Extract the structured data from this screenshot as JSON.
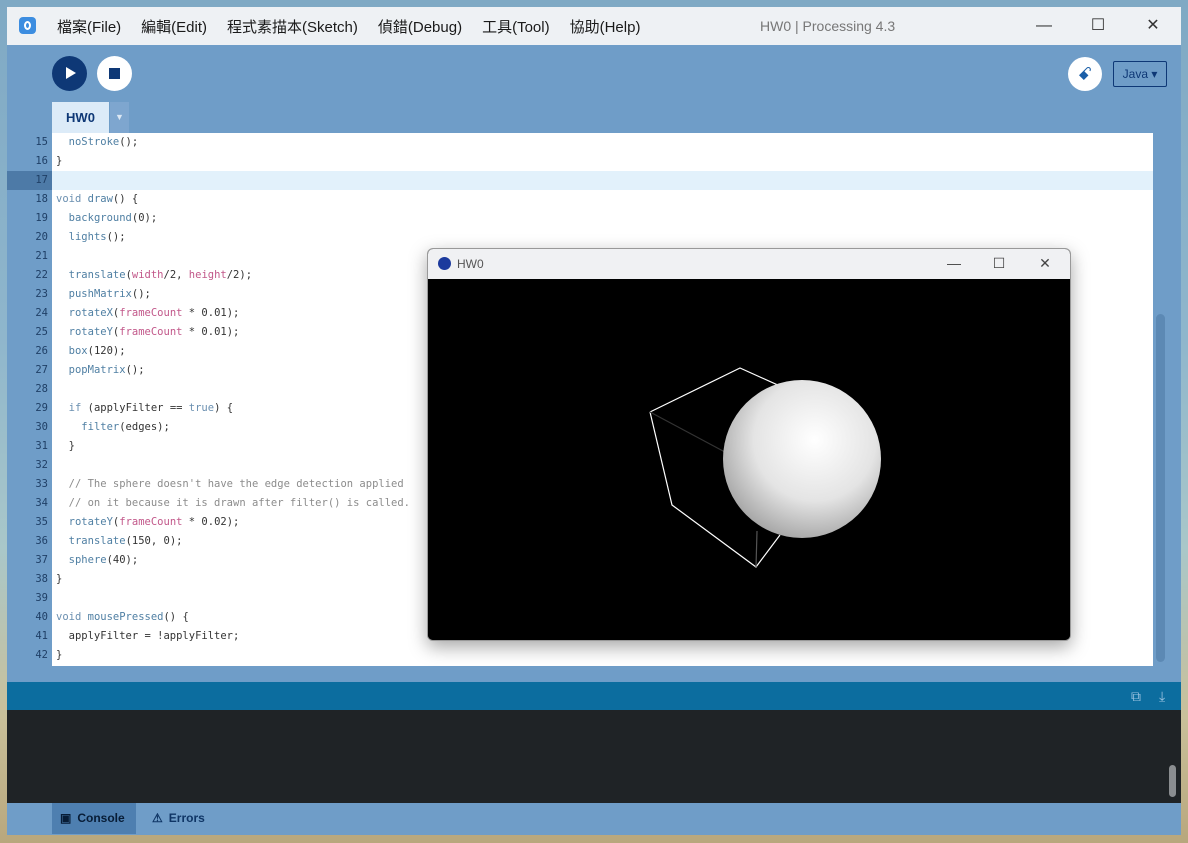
{
  "titlebar": {
    "menu": [
      "檔案(File)",
      "編輯(Edit)",
      "程式素描本(Sketch)",
      "偵錯(Debug)",
      "工具(Tool)",
      "協助(Help)"
    ],
    "window_title": "HW0 | Processing 4.3"
  },
  "toolbar": {
    "mode": "Java ▾"
  },
  "tabs": {
    "active": "HW0"
  },
  "editor": {
    "lines": [
      {
        "n": "15",
        "code": "  noStroke();"
      },
      {
        "n": "16",
        "code": "}"
      },
      {
        "n": "17",
        "code": ""
      },
      {
        "n": "18",
        "code": "void draw() {"
      },
      {
        "n": "19",
        "code": "  background(0);"
      },
      {
        "n": "20",
        "code": "  lights();"
      },
      {
        "n": "21",
        "code": ""
      },
      {
        "n": "22",
        "code": "  translate(width/2, height/2);"
      },
      {
        "n": "23",
        "code": "  pushMatrix();"
      },
      {
        "n": "24",
        "code": "  rotateX(frameCount * 0.01);"
      },
      {
        "n": "25",
        "code": "  rotateY(frameCount * 0.01);"
      },
      {
        "n": "26",
        "code": "  box(120);"
      },
      {
        "n": "27",
        "code": "  popMatrix();"
      },
      {
        "n": "28",
        "code": ""
      },
      {
        "n": "29",
        "code": "  if (applyFilter == true) {"
      },
      {
        "n": "30",
        "code": "    filter(edges);"
      },
      {
        "n": "31",
        "code": "  }"
      },
      {
        "n": "32",
        "code": ""
      },
      {
        "n": "33",
        "code": "  // The sphere doesn't have the edge detection applied"
      },
      {
        "n": "34",
        "code": "  // on it because it is drawn after filter() is called."
      },
      {
        "n": "35",
        "code": "  rotateY(frameCount * 0.02);"
      },
      {
        "n": "36",
        "code": "  translate(150, 0);"
      },
      {
        "n": "37",
        "code": "  sphere(40);"
      },
      {
        "n": "38",
        "code": "}"
      },
      {
        "n": "39",
        "code": ""
      },
      {
        "n": "40",
        "code": "void mousePressed() {"
      },
      {
        "n": "41",
        "code": "  applyFilter = !applyFilter;"
      },
      {
        "n": "42",
        "code": "}"
      }
    ],
    "current_line": "17"
  },
  "sketch_window": {
    "title": "HW0"
  },
  "footer": {
    "console_tab": "Console",
    "errors_tab": "Errors"
  },
  "colors": {
    "keyword": "#6a8fb0",
    "function": "#4f7fa3",
    "builtin_var": "#c2588a",
    "comment": "#8c8c8c",
    "accent": "#0e3876"
  }
}
